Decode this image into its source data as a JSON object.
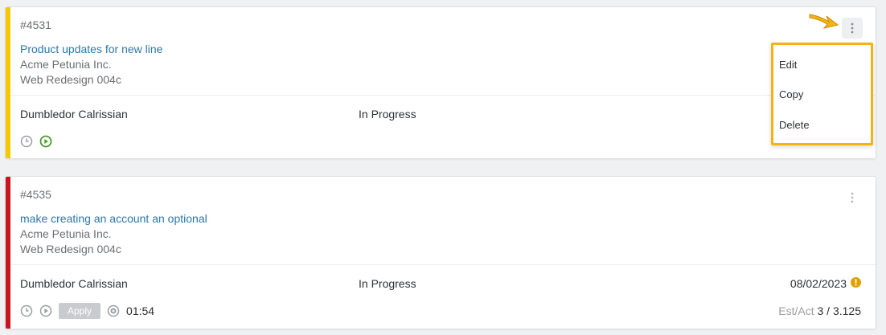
{
  "cards": [
    {
      "id": "#4531",
      "title": "Product updates for new line",
      "client": "Acme Petunia Inc.",
      "project": "Web Redesign 004c",
      "assignee": "Dumbledor Calrissian",
      "status": "In Progress",
      "accent_color": "#f5c800",
      "icons": [
        "clock-icon",
        "play-icon"
      ]
    },
    {
      "id": "#4535",
      "title": "make creating an account an optional",
      "client": "Acme Petunia Inc.",
      "project": "Web Redesign 004c",
      "assignee": "Dumbledor Calrissian",
      "status": "In Progress",
      "due_date": "08/02/2023",
      "apply_label": "Apply",
      "timer": "01:54",
      "est_act_label": "Est/Act",
      "est_act_value": "3 / 3.125",
      "accent_color": "#c9151c",
      "icons": [
        "clock-icon",
        "play-icon",
        "cancel-icon",
        "warning-icon"
      ]
    }
  ],
  "context_menu": {
    "items": [
      "Edit",
      "Copy",
      "Delete"
    ],
    "highlight_color": "#f2b414"
  },
  "colors": {
    "link": "#2c77a8",
    "play_green": "#4a9a2a",
    "warning": "#e0a100"
  }
}
